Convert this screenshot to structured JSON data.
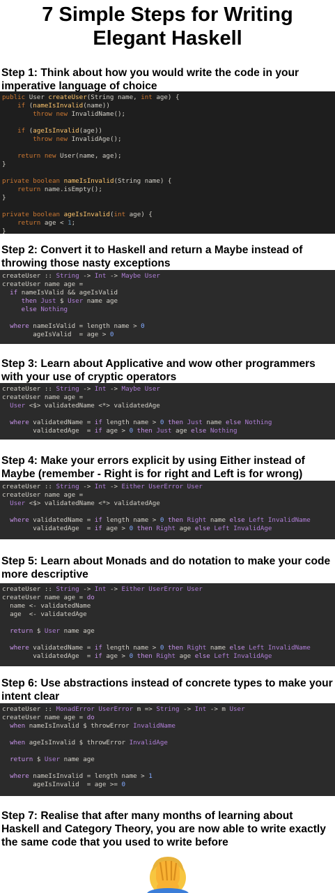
{
  "title": {
    "line1": "7 Simple Steps for Writing",
    "line2": "Elegant Haskell"
  },
  "steps": [
    {
      "heading": "Step 1: Think about how you would write the code in your imperative language of choice"
    },
    {
      "heading": "Step 2: Convert it to Haskell and return a Maybe instead of throwing those nasty exceptions"
    },
    {
      "heading": "Step 3: Learn about Applicative and wow other programmers with your use of cryptic operators"
    },
    {
      "heading": "Step 4: Make your errors explicit by using Either instead of Maybe (remember - Right is for right and Left is for wrong)"
    },
    {
      "heading": "Step 5: Learn about Monads and do notation to make your code more descriptive"
    },
    {
      "heading": "Step 6: Use abstractions instead of concrete types to make your intent clear"
    },
    {
      "heading": "Step 7: Realise that after many months of learning about Haskell and Category Theory, you are now able to write exactly the same code that you used to write before"
    }
  ],
  "code1": [
    "public User createUser(String name, int age) {",
    "    if (nameIsInvalid(name))",
    "        throw new InvalidName();",
    "",
    "    if (ageIsInvalid(age))",
    "        throw new InvalidAge();",
    "",
    "    return new User(name, age);",
    "}",
    "",
    "private boolean nameIsInvalid(String name) {",
    "    return name.isEmpty();",
    "}",
    "",
    "private boolean ageIsInvalid(int age) {",
    "    return age < 1;",
    "}"
  ],
  "code2": [
    "createUser :: String -> Int -> Maybe User",
    "createUser name age =",
    "  if nameIsValid && ageIsValid",
    "     then Just $ User name age",
    "     else Nothing",
    "",
    "  where nameIsValid = length name > 0",
    "        ageIsValid  = age > 0"
  ],
  "code3": [
    "createUser :: String -> Int -> Maybe User",
    "createUser name age =",
    "  User <$> validatedName <*> validatedAge",
    "",
    "  where validatedName = if length name > 0 then Just name else Nothing",
    "        validatedAge  = if age > 0 then Just age else Nothing"
  ],
  "code4": [
    "createUser :: String -> Int -> Either UserError User",
    "createUser name age =",
    "  User <$> validatedName <*> validatedAge",
    "",
    "  where validatedName = if length name > 0 then Right name else Left InvalidName",
    "        validatedAge  = if age > 0 then Right age else Left InvalidAge"
  ],
  "code5": [
    "createUser :: String -> Int -> Either UserError User",
    "createUser name age = do",
    "  name <- validatedName",
    "  age  <- validatedAge",
    "",
    "  return $ User name age",
    "",
    "  where validatedName = if length name > 0 then Right name else Left InvalidName",
    "        validatedAge  = if age > 0 then Right age else Left InvalidAge"
  ],
  "code6": [
    "createUser :: MonadError UserError m => String -> Int -> m User",
    "createUser name age = do",
    "  when nameIsInvalid $ throwError InvalidName",
    "",
    "  when ageIsInvalid $ throwError InvalidAge",
    "",
    "  return $ User name age",
    "",
    "  where nameIsInvalid = length name > 1",
    "        ageIsInvalid  = age >= 0"
  ],
  "emoji": "face-palm-emoji",
  "colors": {
    "code_bg": "#2b2b2b",
    "java_keyword": "#cc7832",
    "java_method": "#ffc66d",
    "haskell_keyword": "#c792ea",
    "number": "#82aaff"
  }
}
